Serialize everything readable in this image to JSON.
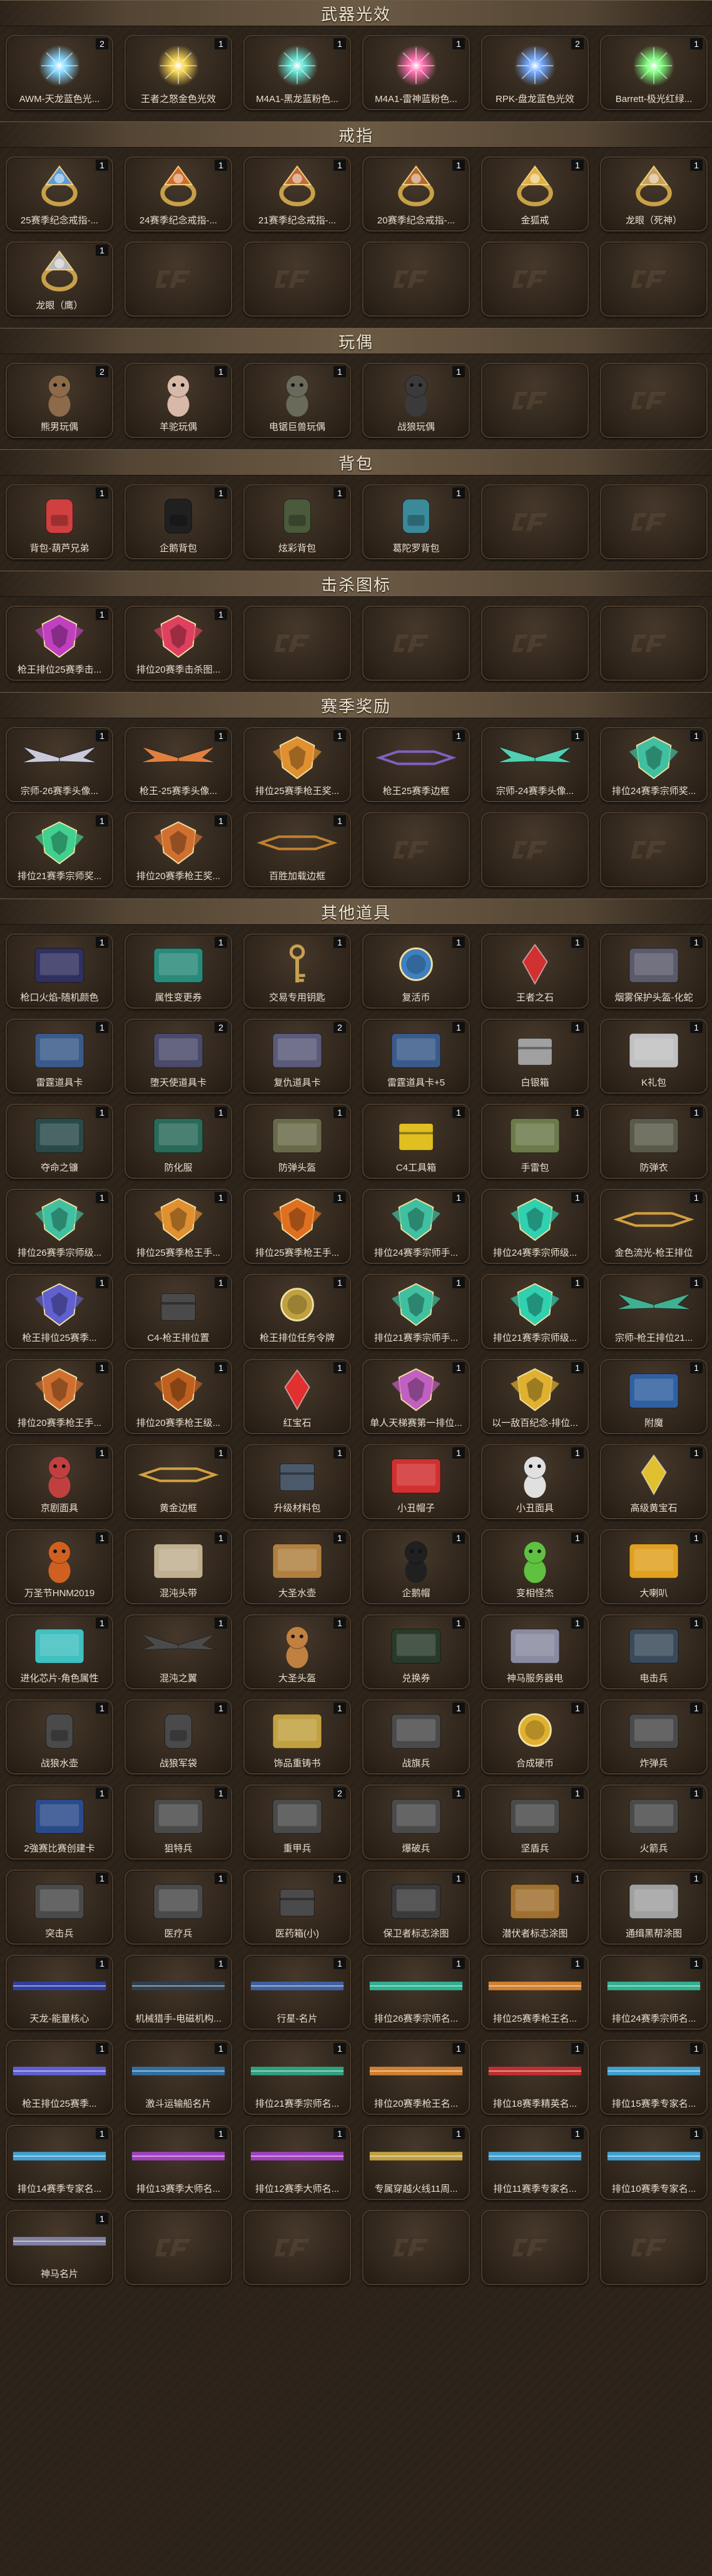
{
  "sections": [
    {
      "title": "武器光效",
      "items": [
        {
          "label": "AWM-天龙蓝色光...",
          "count": "2",
          "icon": "glow-orb-blue-icon",
          "color": "#7fd4ff"
        },
        {
          "label": "王者之怒金色光效",
          "count": "1",
          "icon": "glow-orb-gold-icon",
          "color": "#f2d24a"
        },
        {
          "label": "M4A1-黑龙蓝粉色...",
          "count": "1",
          "icon": "glow-orb-teal-icon",
          "color": "#5fe0d0"
        },
        {
          "label": "M4A1-雷神蓝粉色...",
          "count": "1",
          "icon": "glow-orb-pink-icon",
          "color": "#ff6fb0"
        },
        {
          "label": "RPK-盘龙蓝色光效",
          "count": "2",
          "icon": "glow-orb-blue-icon",
          "color": "#6fa8ff"
        },
        {
          "label": "Barrett-极光红绿...",
          "count": "1",
          "icon": "glow-orb-green-icon",
          "color": "#7cff7c"
        }
      ]
    },
    {
      "title": "戒指",
      "items": [
        {
          "label": "25赛季纪念戒指-...",
          "count": "1",
          "icon": "ring-icon",
          "color": "#5a9bd8"
        },
        {
          "label": "24赛季纪念戒指-...",
          "count": "1",
          "icon": "ring-icon",
          "color": "#d06a2a"
        },
        {
          "label": "21赛季纪念戒指-...",
          "count": "1",
          "icon": "ring-icon",
          "color": "#c26b3a"
        },
        {
          "label": "20赛季纪念戒指-...",
          "count": "1",
          "icon": "ring-icon",
          "color": "#b46a30"
        },
        {
          "label": "金狐戒",
          "count": "1",
          "icon": "fox-ring-icon",
          "color": "#e0b040"
        },
        {
          "label": "龙眼（死神）",
          "count": "1",
          "icon": "dragon-ring-icon",
          "color": "#c8a060"
        },
        {
          "label": "龙眼（鹰）",
          "count": "1",
          "icon": "dragon-ring-icon",
          "color": "#b8b8b8"
        },
        {
          "empty": true
        },
        {
          "empty": true
        },
        {
          "empty": true
        },
        {
          "empty": true
        },
        {
          "empty": true
        }
      ]
    },
    {
      "title": "玩偶",
      "items": [
        {
          "label": "熊男玩偶",
          "count": "2",
          "icon": "doll-icon",
          "color": "#8c6a4a"
        },
        {
          "label": "羊驼玩偶",
          "count": "1",
          "icon": "alpaca-doll-icon",
          "color": "#d8b8a8"
        },
        {
          "label": "电锯巨兽玩偶",
          "count": "1",
          "icon": "beast-doll-icon",
          "color": "#6a6a5a"
        },
        {
          "label": "战狼玩偶",
          "count": "1",
          "icon": "soldier-doll-icon",
          "color": "#3a3a3a"
        },
        {
          "empty": true
        },
        {
          "empty": true
        }
      ]
    },
    {
      "title": "背包",
      "items": [
        {
          "label": "背包-葫芦兄弟",
          "count": "1",
          "icon": "backpack-icon",
          "color": "#d04040"
        },
        {
          "label": "企鹅背包",
          "count": "1",
          "icon": "penguin-backpack-icon",
          "color": "#202020"
        },
        {
          "label": "炫彩背包",
          "count": "1",
          "icon": "backpack-icon",
          "color": "#4a5a3a"
        },
        {
          "label": "葛陀罗背包",
          "count": "1",
          "icon": "backpack-icon",
          "color": "#3a8a9a"
        },
        {
          "empty": true
        },
        {
          "empty": true
        }
      ]
    },
    {
      "title": "击杀图标",
      "items": [
        {
          "label": "枪王排位25赛季击...",
          "count": "1",
          "icon": "kill-emblem-icon",
          "color": "#c040c0"
        },
        {
          "label": "排位20赛季击杀图...",
          "count": "1",
          "icon": "kill-emblem-icon",
          "color": "#e04060"
        },
        {
          "empty": true
        },
        {
          "empty": true
        },
        {
          "empty": true
        },
        {
          "empty": true
        }
      ]
    },
    {
      "title": "赛季奖励",
      "items": [
        {
          "label": "宗师-26赛季头像...",
          "count": "1",
          "icon": "wing-frame-icon",
          "color": "#c9c9d9"
        },
        {
          "label": "枪王-25赛季头像...",
          "count": "1",
          "icon": "wing-frame-icon",
          "color": "#e08040"
        },
        {
          "label": "排位25赛季枪王奖...",
          "count": "1",
          "icon": "rank-badge-icon",
          "color": "#e09030"
        },
        {
          "label": "枪王25赛季边框",
          "count": "1",
          "icon": "frame-icon",
          "color": "#8060c0"
        },
        {
          "label": "宗师-24赛季头像...",
          "count": "1",
          "icon": "wing-frame-icon",
          "color": "#50d0b0"
        },
        {
          "label": "排位24赛季宗师奖...",
          "count": "1",
          "icon": "rank-badge-icon",
          "color": "#40c0a0"
        },
        {
          "label": "排位21赛季宗师奖...",
          "count": "1",
          "icon": "rank-badge-icon",
          "color": "#40d090"
        },
        {
          "label": "排位20赛季枪王奖...",
          "count": "1",
          "icon": "rank-badge-icon",
          "color": "#d07030"
        },
        {
          "label": "百胜加载边框",
          "count": "1",
          "icon": "frame-icon",
          "color": "#c08030"
        },
        {
          "empty": true
        },
        {
          "empty": true
        },
        {
          "empty": true
        }
      ]
    },
    {
      "title": "其他道具",
      "items": [
        {
          "label": "枪口火焰-随机颜色",
          "count": "1",
          "icon": "card-icon",
          "color": "#303060"
        },
        {
          "label": "属性变更券",
          "count": "1",
          "icon": "ticket-icon",
          "color": "#2a8a7a"
        },
        {
          "label": "交易专用钥匙",
          "count": "1",
          "icon": "key-icon",
          "color": "#c8a050"
        },
        {
          "label": "复活币",
          "count": "1",
          "icon": "coin-icon",
          "color": "#4080c0"
        },
        {
          "label": "王者之石",
          "count": "1",
          "icon": "gem-icon",
          "color": "#d03030"
        },
        {
          "label": "烟雾保护头盔-化蛇",
          "count": "1",
          "icon": "helmet-icon",
          "color": "#5a5a6a"
        },
        {
          "label": "雷霆道具卡",
          "count": "1",
          "icon": "card-icon",
          "color": "#3a5a8a"
        },
        {
          "label": "堕天使道具卡",
          "count": "2",
          "icon": "card-icon",
          "color": "#4a4a6a"
        },
        {
          "label": "复仇道具卡",
          "count": "2",
          "icon": "card-icon",
          "color": "#5a5a7a"
        },
        {
          "label": "雷霆道具卡+5",
          "count": "1",
          "icon": "card-icon",
          "color": "#3a5a8a"
        },
        {
          "label": "白银箱",
          "count": "1",
          "icon": "chest-icon",
          "color": "#a0a0a0"
        },
        {
          "label": "K礼包",
          "count": "1",
          "icon": "gift-icon",
          "color": "#c0c0c0"
        },
        {
          "label": "夺命之镰",
          "count": "1",
          "icon": "card-icon",
          "color": "#2a4a4a"
        },
        {
          "label": "防化服",
          "count": "1",
          "icon": "card-icon",
          "color": "#2a6a5a"
        },
        {
          "label": "防弹头盔",
          "count": "1",
          "icon": "helmet-icon",
          "color": "#6a6a4a"
        },
        {
          "label": "C4工具箱",
          "count": "1",
          "icon": "toolbox-icon",
          "color": "#e0c020"
        },
        {
          "label": "手雷包",
          "count": "1",
          "icon": "grenade-icon",
          "color": "#6a7a4a"
        },
        {
          "label": "防弹衣",
          "count": "1",
          "icon": "vest-icon",
          "color": "#5a5a4a"
        },
        {
          "label": "排位26赛季宗师级...",
          "count": "1",
          "icon": "rank-badge-icon",
          "color": "#40c0a0"
        },
        {
          "label": "排位25赛季枪王手...",
          "count": "1",
          "icon": "rank-badge-icon",
          "color": "#e09030"
        },
        {
          "label": "排位25赛季枪王手...",
          "count": "1",
          "icon": "rank-badge-icon",
          "color": "#e07020"
        },
        {
          "label": "排位24赛季宗师手...",
          "count": "1",
          "icon": "rank-badge-icon",
          "color": "#40c0a0"
        },
        {
          "label": "排位24赛季宗师级...",
          "count": "1",
          "icon": "rank-badge-icon",
          "color": "#30d0b0"
        },
        {
          "label": "金色流光-枪王排位",
          "count": "1",
          "icon": "frame-icon",
          "color": "#d0a040"
        },
        {
          "label": "枪王排位25赛季...",
          "count": "1",
          "icon": "rank-badge-icon",
          "color": "#6060d0"
        },
        {
          "label": "C4-枪王排位置",
          "count": "1",
          "icon": "c4-icon",
          "color": "#4a4a4a"
        },
        {
          "label": "枪王排位任务令牌",
          "count": "1",
          "icon": "coin-icon",
          "color": "#c0a040"
        },
        {
          "label": "排位21赛季宗师手...",
          "count": "1",
          "icon": "rank-badge-icon",
          "color": "#40c0a0"
        },
        {
          "label": "排位21赛季宗师级...",
          "count": "1",
          "icon": "rank-badge-icon",
          "color": "#30d0b0"
        },
        {
          "label": "宗师-枪王排位21...",
          "count": "1",
          "icon": "wing-frame-icon",
          "color": "#40b090"
        },
        {
          "label": "排位20赛季枪王手...",
          "count": "1",
          "icon": "rank-badge-icon",
          "color": "#d07030"
        },
        {
          "label": "排位20赛季枪王级...",
          "count": "1",
          "icon": "rank-badge-icon",
          "color": "#c06020"
        },
        {
          "label": "红宝石",
          "count": "1",
          "icon": "gem-icon",
          "color": "#e03030"
        },
        {
          "label": "单人天梯赛第一排位...",
          "count": "1",
          "icon": "rank-badge-icon",
          "color": "#c060c0"
        },
        {
          "label": "以一敌百纪念-排位...",
          "count": "1",
          "icon": "trophy-icon",
          "color": "#e0b030"
        },
        {
          "label": "附魔",
          "count": "1",
          "icon": "card-icon",
          "color": "#3060a0"
        },
        {
          "label": "京剧面具",
          "count": "1",
          "icon": "mask-icon",
          "color": "#c04040"
        },
        {
          "label": "黄金边框",
          "count": "1",
          "icon": "frame-icon",
          "color": "#d0a040"
        },
        {
          "label": "升级材料包",
          "count": "1",
          "icon": "chest-icon",
          "color": "#4a5a6a"
        },
        {
          "label": "小丑帽子",
          "count": "1",
          "icon": "jester-hat-icon",
          "color": "#d03030"
        },
        {
          "label": "小丑面具",
          "count": "1",
          "icon": "mask-icon",
          "color": "#e0e0e0"
        },
        {
          "label": "高级黄宝石",
          "count": "1",
          "icon": "gem-icon",
          "color": "#e0c030"
        },
        {
          "label": "万圣节HNM2019",
          "count": "1",
          "icon": "doll-icon",
          "color": "#d06020"
        },
        {
          "label": "混沌头带",
          "count": "1",
          "icon": "headband-icon",
          "color": "#c0b090"
        },
        {
          "label": "大圣水壶",
          "count": "1",
          "icon": "gourd-icon",
          "color": "#b08040"
        },
        {
          "label": "企鹅帽",
          "count": "1",
          "icon": "penguin-icon",
          "color": "#202020"
        },
        {
          "label": "变相怪杰",
          "count": "1",
          "icon": "mask-icon",
          "color": "#60c040"
        },
        {
          "label": "大喇叭",
          "count": "1",
          "icon": "horn-icon",
          "color": "#e0a020"
        },
        {
          "label": "进化芯片-角色属性",
          "count": "1",
          "icon": "chip-icon",
          "color": "#40c0c0"
        },
        {
          "label": "混沌之翼",
          "count": "1",
          "icon": "wings-icon",
          "color": "#4a4a4a"
        },
        {
          "label": "大圣头盔",
          "count": "1",
          "icon": "monkey-helmet-icon",
          "color": "#c08040"
        },
        {
          "label": "兑换券",
          "count": "1",
          "icon": "coupon-icon",
          "color": "#2a3a2a"
        },
        {
          "label": "神马服务器电",
          "count": "1",
          "icon": "card-icon",
          "color": "#8a8aa0"
        },
        {
          "label": "电击兵",
          "count": "1",
          "icon": "soldier-icon",
          "color": "#3a4a5a"
        },
        {
          "label": "战狼水壶",
          "count": "1",
          "icon": "canteen-icon",
          "color": "#4a4a4a"
        },
        {
          "label": "战狼军袋",
          "count": "1",
          "icon": "bag-icon",
          "color": "#4a4a4a"
        },
        {
          "label": "饰品重铸书",
          "count": "1",
          "icon": "book-icon",
          "color": "#c0a040"
        },
        {
          "label": "战旗兵",
          "count": "1",
          "icon": "soldier-icon",
          "color": "#4a4a4a"
        },
        {
          "label": "合成硬币",
          "count": "1",
          "icon": "coin-icon",
          "color": "#e0b030"
        },
        {
          "label": "炸弹兵",
          "count": "1",
          "icon": "soldier-icon",
          "color": "#4a4a4a"
        },
        {
          "label": "2強赛比赛创建卡",
          "count": "1",
          "icon": "card-icon",
          "color": "#2a4a8a"
        },
        {
          "label": "狙特兵",
          "count": "1",
          "icon": "soldier-icon",
          "color": "#4a4a4a"
        },
        {
          "label": "重甲兵",
          "count": "2",
          "icon": "soldier-icon",
          "color": "#4a4a4a"
        },
        {
          "label": "爆破兵",
          "count": "1",
          "icon": "soldier-icon",
          "color": "#4a4a4a"
        },
        {
          "label": "坚盾兵",
          "count": "1",
          "icon": "soldier-icon",
          "color": "#4a4a4a"
        },
        {
          "label": "火箭兵",
          "count": "1",
          "icon": "soldier-icon",
          "color": "#4a4a4a"
        },
        {
          "label": "突击兵",
          "count": "1",
          "icon": "soldier-icon",
          "color": "#4a4a4a"
        },
        {
          "label": "医疗兵",
          "count": "1",
          "icon": "soldier-icon",
          "color": "#4a4a4a"
        },
        {
          "label": "医药箱(小)",
          "count": "1",
          "icon": "medkit-icon",
          "color": "#4a4a4a"
        },
        {
          "label": "保卫者标志涂图",
          "count": "1",
          "icon": "spray-icon",
          "color": "#3a3a3a"
        },
        {
          "label": "潜伏者标志涂图",
          "count": "1",
          "icon": "spray-icon",
          "color": "#a07030"
        },
        {
          "label": "通缉黑帮涂图",
          "count": "1",
          "icon": "spray-icon",
          "color": "#a0a0a0"
        },
        {
          "label": "天龙-能量核心",
          "count": "1",
          "icon": "name-card-icon",
          "color": "#3040a0"
        },
        {
          "label": "机械猎手-电磁机构...",
          "count": "1",
          "icon": "name-card-icon",
          "color": "#304050"
        },
        {
          "label": "行星-名片",
          "count": "1",
          "icon": "name-card-icon",
          "color": "#4060a0"
        },
        {
          "label": "排位26赛季宗师名...",
          "count": "1",
          "icon": "name-card-icon",
          "color": "#30b090"
        },
        {
          "label": "排位25赛季枪王名...",
          "count": "1",
          "icon": "name-card-icon",
          "color": "#d08030"
        },
        {
          "label": "排位24赛季宗师名...",
          "count": "1",
          "icon": "name-card-icon",
          "color": "#30b090"
        },
        {
          "label": "枪王排位25赛季...",
          "count": "1",
          "icon": "name-card-icon",
          "color": "#6060d0"
        },
        {
          "label": "激斗运输船名片",
          "count": "1",
          "icon": "name-card-icon",
          "color": "#3070a0"
        },
        {
          "label": "排位21赛季宗师名...",
          "count": "1",
          "icon": "name-card-icon",
          "color": "#30a080"
        },
        {
          "label": "排位20赛季枪王名...",
          "count": "1",
          "icon": "name-card-icon",
          "color": "#d08030"
        },
        {
          "label": "排位18赛季精英名...",
          "count": "1",
          "icon": "name-card-icon",
          "color": "#c03030"
        },
        {
          "label": "排位15赛季专家名...",
          "count": "1",
          "icon": "name-card-icon",
          "color": "#40a0d0"
        },
        {
          "label": "排位14赛季专家名...",
          "count": "1",
          "icon": "name-card-icon",
          "color": "#40a0d0"
        },
        {
          "label": "排位13赛季大师名...",
          "count": "1",
          "icon": "name-card-icon",
          "color": "#a040c0"
        },
        {
          "label": "排位12赛季大师名...",
          "count": "1",
          "icon": "name-card-icon",
          "color": "#a040c0"
        },
        {
          "label": "专属穿越火线11周...",
          "count": "1",
          "icon": "name-card-icon",
          "color": "#c0a040"
        },
        {
          "label": "排位11赛季专家名...",
          "count": "1",
          "icon": "name-card-icon",
          "color": "#40a0d0"
        },
        {
          "label": "排位10赛季专家名...",
          "count": "1",
          "icon": "name-card-icon",
          "color": "#40a0d0"
        },
        {
          "label": "神马名片",
          "count": "1",
          "icon": "name-card-icon",
          "color": "#8080a0"
        },
        {
          "empty": true
        },
        {
          "empty": true
        },
        {
          "empty": true
        },
        {
          "empty": true
        },
        {
          "empty": true
        }
      ]
    }
  ]
}
